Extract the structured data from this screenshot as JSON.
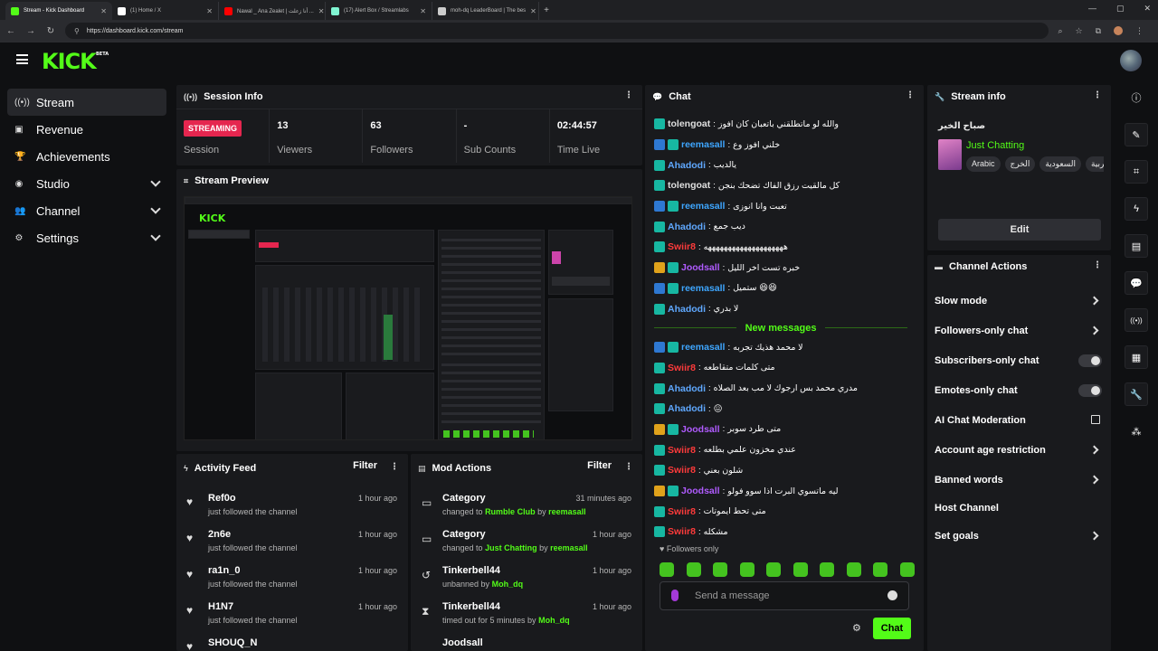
{
  "browser": {
    "tabs": [
      {
        "title": "Stream - Kick Dashboard",
        "color": "#53fc18",
        "active": true
      },
      {
        "title": "(1) Home / X",
        "color": "#ffffff",
        "active": false
      },
      {
        "title": "Nawal _ Ana Zealet | أنا زعلت ...",
        "color": "#ff0000",
        "active": false
      },
      {
        "title": "(17) Alert Box / Streamlabs",
        "color": "#80f5d2",
        "active": false
      },
      {
        "title": "moh-dq LeaderBoard | The bes",
        "color": "#cccccc",
        "active": false
      }
    ],
    "url": "https://dashboard.kick.com/stream"
  },
  "header": {
    "logo": "KICK",
    "logo_badge": "BETA"
  },
  "sidebar": {
    "items": [
      {
        "label": "Stream",
        "icon": "broadcast-icon",
        "glyph": "((•))",
        "active": true,
        "expandable": false
      },
      {
        "label": "Revenue",
        "icon": "revenue-icon",
        "glyph": "▣",
        "active": false,
        "expandable": false
      },
      {
        "label": "Achievements",
        "icon": "trophy-icon",
        "glyph": "🏆",
        "active": false,
        "expandable": false
      },
      {
        "label": "Studio",
        "icon": "studio-icon",
        "glyph": "◉",
        "active": false,
        "expandable": true
      },
      {
        "label": "Channel",
        "icon": "channel-icon",
        "glyph": "👥",
        "active": false,
        "expandable": true
      },
      {
        "label": "Settings",
        "icon": "gear-icon",
        "glyph": "⚙",
        "active": false,
        "expandable": true
      }
    ]
  },
  "session": {
    "title": "Session Info",
    "status": "STREAMING",
    "session_label": "Session",
    "viewers": "13",
    "viewers_label": "Viewers",
    "followers": "63",
    "followers_label": "Followers",
    "subs": "-",
    "subs_label": "Sub Counts",
    "time": "02:44:57",
    "time_label": "Time Live"
  },
  "preview": {
    "title": "Stream Preview"
  },
  "activity": {
    "title": "Activity Feed",
    "filter": "Filter",
    "items": [
      {
        "name": "Ref0o",
        "sub": "just followed the channel",
        "time": "1 hour ago"
      },
      {
        "name": "2n6e",
        "sub": "just followed the channel",
        "time": "1 hour ago"
      },
      {
        "name": "ra1n_0",
        "sub": "just followed the channel",
        "time": "1 hour ago"
      },
      {
        "name": "H1N7",
        "sub": "just followed the channel",
        "time": "1 hour ago"
      },
      {
        "name": "SHOUQ_N",
        "sub": "",
        "time": ""
      }
    ]
  },
  "mod": {
    "title": "Mod Actions",
    "filter": "Filter",
    "items": [
      {
        "name": "Category",
        "pre": "changed to",
        "hl": "Rumble Club",
        "mid": "by",
        "by": "reemasall",
        "time": "31 minutes ago",
        "icon": "category-icon",
        "glyph": "▭"
      },
      {
        "name": "Category",
        "pre": "changed to",
        "hl": "Just Chatting",
        "mid": "by",
        "by": "reemasall",
        "time": "1 hour ago",
        "icon": "category-icon",
        "glyph": "▭"
      },
      {
        "name": "Tinkerbell44",
        "pre": "unbanned by",
        "hl": "",
        "mid": "",
        "by": "Moh_dq",
        "time": "1 hour ago",
        "icon": "unban-icon",
        "glyph": "↺"
      },
      {
        "name": "Tinkerbell44",
        "pre": "timed out for 5 minutes by",
        "hl": "",
        "mid": "",
        "by": "Moh_dq",
        "time": "1 hour ago",
        "icon": "timeout-icon",
        "glyph": "⧗"
      },
      {
        "name": "Joodsall",
        "pre": "",
        "hl": "",
        "mid": "",
        "by": "",
        "time": "",
        "icon": "category-icon",
        "glyph": ""
      }
    ]
  },
  "chat": {
    "title": "Chat",
    "messages_before": [
      {
        "user": "tolengoat",
        "color": "#dfdfdf",
        "badges": [
          "teal"
        ],
        "text": "والله لو ماتطلقني باتعبان كان افوز"
      },
      {
        "user": "reemasall",
        "color": "#3ea6ff",
        "badges": [
          "blue",
          "teal"
        ],
        "text": "خلني افوز وع"
      },
      {
        "user": "Ahadodi",
        "color": "#5fa8ff",
        "badges": [
          "teal"
        ],
        "text": "يالديب"
      },
      {
        "user": "tolengoat",
        "color": "#dfdfdf",
        "badges": [
          "teal"
        ],
        "text": "كل مالقيت رزق الفاك تضحك بنجن"
      },
      {
        "user": "reemasall",
        "color": "#3ea6ff",
        "badges": [
          "blue",
          "teal"
        ],
        "text": "تعبت وانا انوزى"
      },
      {
        "user": "Ahadodi",
        "color": "#5fa8ff",
        "badges": [
          "teal"
        ],
        "text": "ديب جمع"
      },
      {
        "user": "Swiir8",
        "color": "#ff3b3b",
        "badges": [
          "teal"
        ],
        "text": "ههههههههههههههههههههه"
      },
      {
        "user": "Joodsall",
        "color": "#b05bff",
        "badges": [
          "gold",
          "teal"
        ],
        "text": "خبره تست اخر الليل"
      },
      {
        "user": "reemasall",
        "color": "#3ea6ff",
        "badges": [
          "blue",
          "teal"
        ],
        "text": "ستميل 😆😆"
      },
      {
        "user": "Ahadodi",
        "color": "#5fa8ff",
        "badges": [
          "teal"
        ],
        "text": "لا بدري"
      }
    ],
    "new_messages": "New messages",
    "messages_after": [
      {
        "user": "reemasall",
        "color": "#3ea6ff",
        "badges": [
          "blue",
          "teal"
        ],
        "text": "لا محمد هذيك تجربه"
      },
      {
        "user": "Swiir8",
        "color": "#ff3b3b",
        "badges": [
          "teal"
        ],
        "text": "متى كلمات متقاطعه"
      },
      {
        "user": "Ahadodi",
        "color": "#5fa8ff",
        "badges": [
          "teal"
        ],
        "text": "مدري محمد بس ارجوك لا مب بعد الصلاه"
      },
      {
        "user": "Ahadodi",
        "color": "#5fa8ff",
        "badges": [
          "teal"
        ],
        "text": "😖"
      },
      {
        "user": "Joodsall",
        "color": "#b05bff",
        "badges": [
          "gold",
          "teal"
        ],
        "text": "متى طرد سوبر"
      },
      {
        "user": "Swiir8",
        "color": "#ff3b3b",
        "badges": [
          "teal"
        ],
        "text": "عندي مخزون علمي بطلعه"
      },
      {
        "user": "Swiir8",
        "color": "#ff3b3b",
        "badges": [
          "teal"
        ],
        "text": "شلون بعني"
      },
      {
        "user": "Joodsall",
        "color": "#b05bff",
        "badges": [
          "gold",
          "teal"
        ],
        "text": "ليه ماتسوي البرت اذا سوو فولو"
      },
      {
        "user": "Swiir8",
        "color": "#ff3b3b",
        "badges": [
          "teal"
        ],
        "text": "متى تحط ايموتات"
      },
      {
        "user": "Swiir8",
        "color": "#ff3b3b",
        "badges": [
          "teal"
        ],
        "text": "مشكله"
      }
    ],
    "followers_only": "Followers only",
    "placeholder": "Send a message",
    "send": "Chat",
    "emote_count": 10
  },
  "stream_info": {
    "title": "Stream info",
    "stream_title": "صباح الخير",
    "category": "Just Chatting",
    "tags": [
      "Arabic",
      "الخرج",
      "السعودية",
      "عربية"
    ],
    "edit": "Edit"
  },
  "channel_actions": {
    "title": "Channel Actions",
    "items": [
      {
        "label": "Slow mode",
        "kind": "arrow"
      },
      {
        "label": "Followers-only chat",
        "kind": "arrow"
      },
      {
        "label": "Subscribers-only chat",
        "kind": "toggle"
      },
      {
        "label": "Emotes-only chat",
        "kind": "toggle"
      },
      {
        "label": "AI Chat Moderation",
        "kind": "external"
      },
      {
        "label": "Account age restriction",
        "kind": "arrow"
      },
      {
        "label": "Banned words",
        "kind": "arrow"
      },
      {
        "label": "Host Channel",
        "kind": "none"
      },
      {
        "label": "Set goals",
        "kind": "arrow"
      }
    ]
  },
  "rail": [
    {
      "icon": "info-icon",
      "glyph": "ⓘ"
    },
    {
      "icon": "pencil-icon",
      "glyph": "✎"
    },
    {
      "icon": "focus-icon",
      "glyph": "⌗"
    },
    {
      "icon": "lightning-icon",
      "glyph": "ϟ"
    },
    {
      "icon": "notes-icon",
      "glyph": "▤"
    },
    {
      "icon": "chat-bubble-icon",
      "glyph": "💬"
    },
    {
      "icon": "broadcast-icon",
      "glyph": "((•))"
    },
    {
      "icon": "layout-icon",
      "glyph": "▦"
    },
    {
      "icon": "wrench-icon",
      "glyph": "🔧"
    },
    {
      "icon": "apps-icon",
      "glyph": "⁂"
    }
  ],
  "colors": {
    "accent": "#53fc18",
    "live": "#e5264f",
    "panel": "#191a1d",
    "bg": "#0f1012"
  }
}
